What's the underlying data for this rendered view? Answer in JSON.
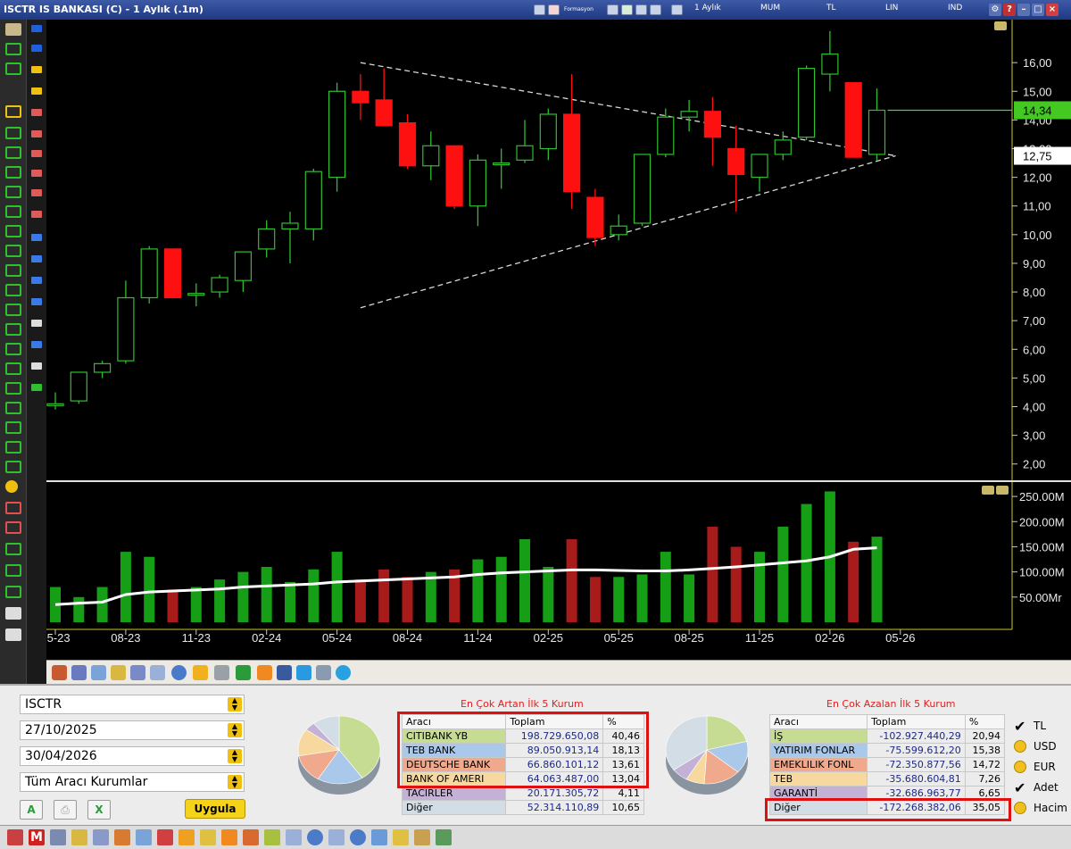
{
  "window": {
    "title": "ISCTR IS BANKASI (C) - 1 Aylık (.1m)",
    "period": "1 Aylık",
    "type": "MUM",
    "currency": "TL",
    "scale": "LIN",
    "ind": "IND",
    "tab_label": "Formasyon"
  },
  "chart_data": {
    "type": "candlestick",
    "x_ticks": [
      "05-23",
      "08-23",
      "11-23",
      "02-24",
      "05-24",
      "08-24",
      "11-24",
      "02-25",
      "05-25",
      "08-25",
      "11-25",
      "02-26",
      "05-26"
    ],
    "y_ticks": [
      "2,00",
      "3,00",
      "4,00",
      "5,00",
      "6,00",
      "7,00",
      "8,00",
      "9,00",
      "10,00",
      "11,00",
      "12,00",
      "13,00",
      "14,00",
      "15,00",
      "16,00"
    ],
    "ylim": [
      1.4,
      17.5
    ],
    "candles": [
      {
        "o": 4.05,
        "h": 4.5,
        "l": 3.9,
        "c": 4.1
      },
      {
        "o": 4.2,
        "h": 5.2,
        "l": 4.1,
        "c": 5.2
      },
      {
        "o": 5.2,
        "h": 5.6,
        "l": 5.0,
        "c": 5.5
      },
      {
        "o": 5.6,
        "h": 8.4,
        "l": 5.5,
        "c": 7.8
      },
      {
        "o": 7.8,
        "h": 9.6,
        "l": 7.6,
        "c": 9.5
      },
      {
        "o": 9.5,
        "h": 9.5,
        "l": 7.8,
        "c": 7.8
      },
      {
        "o": 7.9,
        "h": 8.3,
        "l": 7.5,
        "c": 7.95
      },
      {
        "o": 8.0,
        "h": 8.6,
        "l": 7.8,
        "c": 8.5
      },
      {
        "o": 8.4,
        "h": 9.4,
        "l": 8.0,
        "c": 9.4
      },
      {
        "o": 9.5,
        "h": 10.5,
        "l": 9.2,
        "c": 10.2
      },
      {
        "o": 10.2,
        "h": 10.8,
        "l": 9.0,
        "c": 10.4
      },
      {
        "o": 10.2,
        "h": 12.3,
        "l": 9.8,
        "c": 12.2
      },
      {
        "o": 12.0,
        "h": 15.3,
        "l": 11.5,
        "c": 15.0
      },
      {
        "o": 15.0,
        "h": 15.6,
        "l": 14.0,
        "c": 14.6
      },
      {
        "o": 14.7,
        "h": 15.8,
        "l": 14.0,
        "c": 13.8
      },
      {
        "o": 13.9,
        "h": 14.2,
        "l": 12.3,
        "c": 12.4
      },
      {
        "o": 12.4,
        "h": 13.6,
        "l": 11.9,
        "c": 13.1
      },
      {
        "o": 13.1,
        "h": 13.1,
        "l": 10.9,
        "c": 11.0
      },
      {
        "o": 11.0,
        "h": 12.8,
        "l": 10.3,
        "c": 12.6
      },
      {
        "o": 12.45,
        "h": 13.0,
        "l": 11.6,
        "c": 12.5
      },
      {
        "o": 12.6,
        "h": 14.0,
        "l": 12.5,
        "c": 13.1
      },
      {
        "o": 13.0,
        "h": 14.4,
        "l": 12.6,
        "c": 14.2
      },
      {
        "o": 14.2,
        "h": 15.6,
        "l": 10.9,
        "c": 11.5
      },
      {
        "o": 11.3,
        "h": 11.6,
        "l": 9.6,
        "c": 9.9
      },
      {
        "o": 10.0,
        "h": 10.7,
        "l": 9.8,
        "c": 10.3
      },
      {
        "o": 10.4,
        "h": 12.8,
        "l": 10.3,
        "c": 12.8
      },
      {
        "o": 12.8,
        "h": 14.4,
        "l": 12.7,
        "c": 14.1
      },
      {
        "o": 14.1,
        "h": 14.7,
        "l": 13.6,
        "c": 14.3
      },
      {
        "o": 14.3,
        "h": 14.8,
        "l": 12.4,
        "c": 13.4
      },
      {
        "o": 13.0,
        "h": 13.8,
        "l": 10.8,
        "c": 12.1
      },
      {
        "o": 12.0,
        "h": 12.8,
        "l": 11.5,
        "c": 12.8
      },
      {
        "o": 12.8,
        "h": 13.6,
        "l": 12.6,
        "c": 13.3
      },
      {
        "o": 13.4,
        "h": 15.9,
        "l": 13.3,
        "c": 15.8
      },
      {
        "o": 15.6,
        "h": 17.1,
        "l": 15.0,
        "c": 16.3
      },
      {
        "o": 15.3,
        "h": 15.3,
        "l": 12.7,
        "c": 12.7
      },
      {
        "o": 12.8,
        "h": 15.1,
        "l": 12.6,
        "c": 14.34
      }
    ],
    "last_price": "14,34",
    "cursor_price": "12,75",
    "trend_lines": [
      {
        "from": {
          "i": 13,
          "v": 16.0
        },
        "to": {
          "i": 35.8,
          "v": 12.75
        }
      },
      {
        "from": {
          "i": 13,
          "v": 7.45
        },
        "to": {
          "i": 35.8,
          "v": 12.75
        }
      }
    ],
    "volume": {
      "y_ticks": [
        "50.00Mr",
        "100.00M",
        "150.00M",
        "200.00M",
        "250.00M"
      ],
      "ylim": [
        0,
        275
      ],
      "values": [
        70,
        50,
        70,
        140,
        130,
        65,
        70,
        85,
        100,
        110,
        80,
        105,
        140,
        85,
        105,
        90,
        100,
        105,
        125,
        130,
        165,
        110,
        165,
        90,
        90,
        95,
        140,
        95,
        190,
        150,
        140,
        190,
        235,
        260,
        160,
        170
      ],
      "ma": [
        35,
        38,
        40,
        55,
        60,
        62,
        64,
        66,
        70,
        72,
        74,
        76,
        80,
        82,
        84,
        86,
        88,
        90,
        95,
        98,
        100,
        102,
        104,
        104,
        103,
        102,
        102,
        104,
        107,
        110,
        114,
        118,
        122,
        130,
        145,
        148
      ]
    }
  },
  "filters": {
    "symbol": "ISCTR",
    "start_date": "27/10/2025",
    "end_date": "30/04/2026",
    "broker_filter": "Tüm Aracı Kurumlar",
    "apply_label": "Uygula"
  },
  "top_increase": {
    "title": "En Çok Artan İlk 5 Kurum",
    "headers": [
      "Aracı",
      "Toplam",
      "%"
    ],
    "rows": [
      {
        "name": "CITIBANK YB",
        "total": "198.729.650,08",
        "pct": "40,46",
        "color": "#c6dc92"
      },
      {
        "name": "TEB BANK",
        "total": "89.050.913,14",
        "pct": "18,13",
        "color": "#a9c8ea"
      },
      {
        "name": "DEUTSCHE BANK",
        "total": "66.860.101,12",
        "pct": "13,61",
        "color": "#f0a98c"
      },
      {
        "name": "BANK OF AMERI",
        "total": "64.063.487,00",
        "pct": "13,04",
        "color": "#f7d9a0"
      },
      {
        "name": "TACİRLER",
        "total": "20.171.305,72",
        "pct": "4,11",
        "color": "#c3b2d6"
      },
      {
        "name": "Diğer",
        "total": "52.314.110,89",
        "pct": "10,65",
        "color": "#d3dde6"
      }
    ]
  },
  "top_decrease": {
    "title": "En Çok Azalan İlk 5 Kurum",
    "headers": [
      "Aracı",
      "Toplam",
      "%"
    ],
    "rows": [
      {
        "name": "İŞ",
        "total": "-102.927.440,29",
        "pct": "20,94",
        "color": "#c6dc92"
      },
      {
        "name": "YATIRIM FONLAR",
        "total": "-75.599.612,20",
        "pct": "15,38",
        "color": "#a9c8ea"
      },
      {
        "name": "EMEKLILIK FONL",
        "total": "-72.350.877,56",
        "pct": "14,72",
        "color": "#f0a98c"
      },
      {
        "name": "TEB",
        "total": "-35.680.604,81",
        "pct": "7,26",
        "color": "#f7d9a0"
      },
      {
        "name": "GARANTİ",
        "total": "-32.686.963,77",
        "pct": "6,65",
        "color": "#c3b2d6"
      },
      {
        "name": "Diğer",
        "total": "-172.268.382,06",
        "pct": "35,05",
        "color": "#d3dde6"
      }
    ]
  },
  "currency_options": [
    {
      "label": "TL",
      "checked": true
    },
    {
      "label": "USD",
      "checked": false
    },
    {
      "label": "EUR",
      "checked": false
    },
    {
      "label": "Adet",
      "checked": true
    },
    {
      "label": "Hacim",
      "checked": false
    }
  ]
}
